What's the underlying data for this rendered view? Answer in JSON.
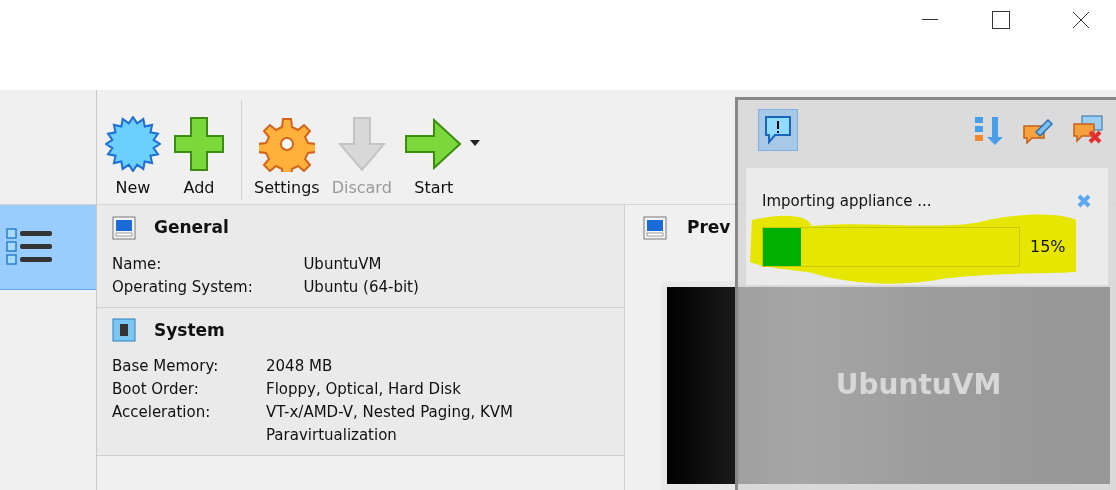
{
  "toolbar": [
    {
      "label": "New",
      "kind": "new",
      "disabled": false,
      "has_menu": false
    },
    {
      "label": "Add",
      "kind": "add",
      "disabled": false,
      "has_menu": false
    },
    {
      "label": "Settings",
      "kind": "settings",
      "disabled": false,
      "has_menu": false
    },
    {
      "label": "Discard",
      "kind": "discard",
      "disabled": true,
      "has_menu": false
    },
    {
      "label": "Start",
      "kind": "start",
      "disabled": false,
      "has_menu": true
    }
  ],
  "tools_sidebar": {
    "items": [
      {
        "selected": true
      }
    ]
  },
  "details": {
    "sections": [
      {
        "title": "General",
        "kind": "general",
        "rows": [
          {
            "label": "Name:",
            "value": "UbuntuVM"
          },
          {
            "label": "Operating System:",
            "value": "Ubuntu (64-bit)"
          }
        ]
      },
      {
        "title": "System",
        "kind": "system",
        "rows": [
          {
            "label": "Base Memory:",
            "value": "2048 MB"
          },
          {
            "label": "Boot Order:",
            "value": "Floppy, Optical, Hard Disk"
          },
          {
            "label": "Acceleration:",
            "value": "VT-x/AMD-V, Nested Paging, KVM Paravirtualization"
          }
        ]
      }
    ]
  },
  "preview": {
    "title": "Prev",
    "screen_text": "UbuntuVM"
  },
  "notification_center": {
    "buttons": [
      {
        "kind": "messages",
        "selected": true
      },
      {
        "kind": "sort",
        "selected": false
      },
      {
        "kind": "keep",
        "selected": false
      },
      {
        "kind": "close_all",
        "selected": false
      }
    ],
    "messages": [
      {
        "text": "Importing appliance ...",
        "level": 0.15,
        "reading": "15%"
      }
    ]
  }
}
